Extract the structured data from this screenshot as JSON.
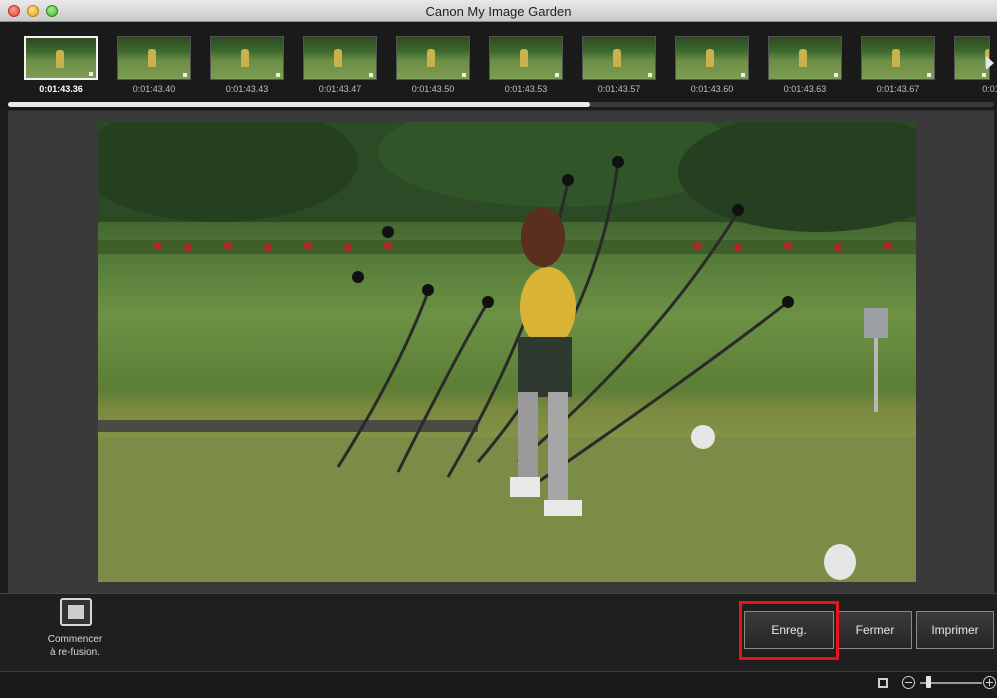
{
  "window": {
    "title": "Canon My Image Garden"
  },
  "filmstrip": {
    "frames": [
      {
        "time": "0:01:43.36",
        "selected": true
      },
      {
        "time": "0:01:43.40",
        "selected": false
      },
      {
        "time": "0:01:43.43",
        "selected": false
      },
      {
        "time": "0:01:43.47",
        "selected": false
      },
      {
        "time": "0:01:43.50",
        "selected": false
      },
      {
        "time": "0:01:43.53",
        "selected": false
      },
      {
        "time": "0:01:43.57",
        "selected": false
      },
      {
        "time": "0:01:43.60",
        "selected": false
      },
      {
        "time": "0:01:43.63",
        "selected": false
      },
      {
        "time": "0:01:43.67",
        "selected": false
      },
      {
        "time": "0:01",
        "selected": false
      }
    ],
    "scroll_position_fraction": 0.59
  },
  "preview": {
    "image": "golf-swing-multi-exposure-composite"
  },
  "actions": {
    "remerge_label": "Commencer\nà re-fusion.",
    "save_label": "Enreg.",
    "close_label": "Fermer",
    "print_label": "Imprimer",
    "highlight_color": "#e8141b"
  },
  "statusbar": {
    "zoom_level_fraction": 0.1
  }
}
